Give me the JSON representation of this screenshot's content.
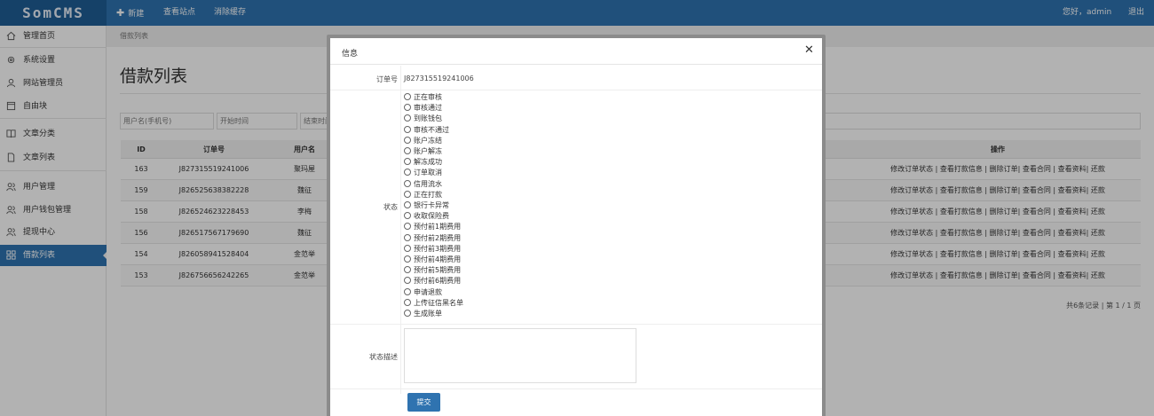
{
  "logo": "SomCMS",
  "topnav": {
    "new": "新建",
    "view_site": "查看站点",
    "clear_cache": "消除缓存",
    "greeting": "您好，admin",
    "logout": "退出"
  },
  "sidebar": {
    "items": [
      {
        "label": "管理首页",
        "icon": "home-icon"
      },
      {
        "label": "系统设置",
        "icon": "gear-icon"
      },
      {
        "label": "网站管理员",
        "icon": "user-icon"
      },
      {
        "label": "自由块",
        "icon": "square-icon"
      },
      {
        "label": "文章分类",
        "icon": "book-icon"
      },
      {
        "label": "文章列表",
        "icon": "document-icon"
      },
      {
        "label": "用户管理",
        "icon": "users-icon"
      },
      {
        "label": "用户钱包管理",
        "icon": "users-icon"
      },
      {
        "label": "提现中心",
        "icon": "users-icon"
      },
      {
        "label": "借款列表",
        "icon": "grid-icon"
      }
    ]
  },
  "breadcrumb": "借款列表",
  "page_title": "借款列表",
  "filters": {
    "username_placeholder": "用户名(手机号)",
    "start_placeholder": "开始时间",
    "end_placeholder": "结束时间"
  },
  "table": {
    "headers": {
      "id": "ID",
      "order": "订单号",
      "user": "用户名",
      "actions": "操作"
    },
    "rows": [
      {
        "id": "163",
        "order": "J827315519241006",
        "user": "聚玛屋",
        "actions": "修改订单状态 | 查看打款信息 | 删除订单| 查看合同 | 查看资料| 还款"
      },
      {
        "id": "159",
        "order": "J826525638382228",
        "user": "魏征",
        "actions": "修改订单状态 | 查看打款信息 | 删除订单| 查看合同 | 查看资料| 还款"
      },
      {
        "id": "158",
        "order": "J826524623228453",
        "user": "李梅",
        "actions": "修改订单状态 | 查看打款信息 | 删除订单| 查看合同 | 查看资料| 还款"
      },
      {
        "id": "156",
        "order": "J826517567179690",
        "user": "魏征",
        "actions": "修改订单状态 | 查看打款信息 | 删除订单| 查看合同 | 查看资料| 还款"
      },
      {
        "id": "154",
        "order": "J826058941528404",
        "user": "金范举",
        "actions": "修改订单状态 | 查看打款信息 | 删除订单| 查看合同 | 查看资料| 还款"
      },
      {
        "id": "153",
        "order": "J826756656242265",
        "user": "金范举",
        "actions": "修改订单状态 | 查看打款信息 | 删除订单| 查看合同 | 查看资料| 还款"
      }
    ]
  },
  "pager": "共6条记录 | 第 1 / 1 页",
  "modal": {
    "title": "信息",
    "order_label": "订单号",
    "order_value": "J827315519241006",
    "status_label": "状态",
    "status_options": [
      "正在审核",
      "审核通过",
      "到账钱包",
      "审核不通过",
      "账户冻结",
      "账户解冻",
      "解冻成功",
      "订单取消",
      "信用流水",
      "正在打款",
      "银行卡异常",
      "收取保险费",
      "预付前1期费用",
      "预付前2期费用",
      "预付前3期费用",
      "预付前4期费用",
      "预付前5期费用",
      "预付前6期费用",
      "申请退款",
      "上传征信黑名单",
      "生成账单"
    ],
    "desc_label": "状态描述",
    "submit": "提交"
  }
}
